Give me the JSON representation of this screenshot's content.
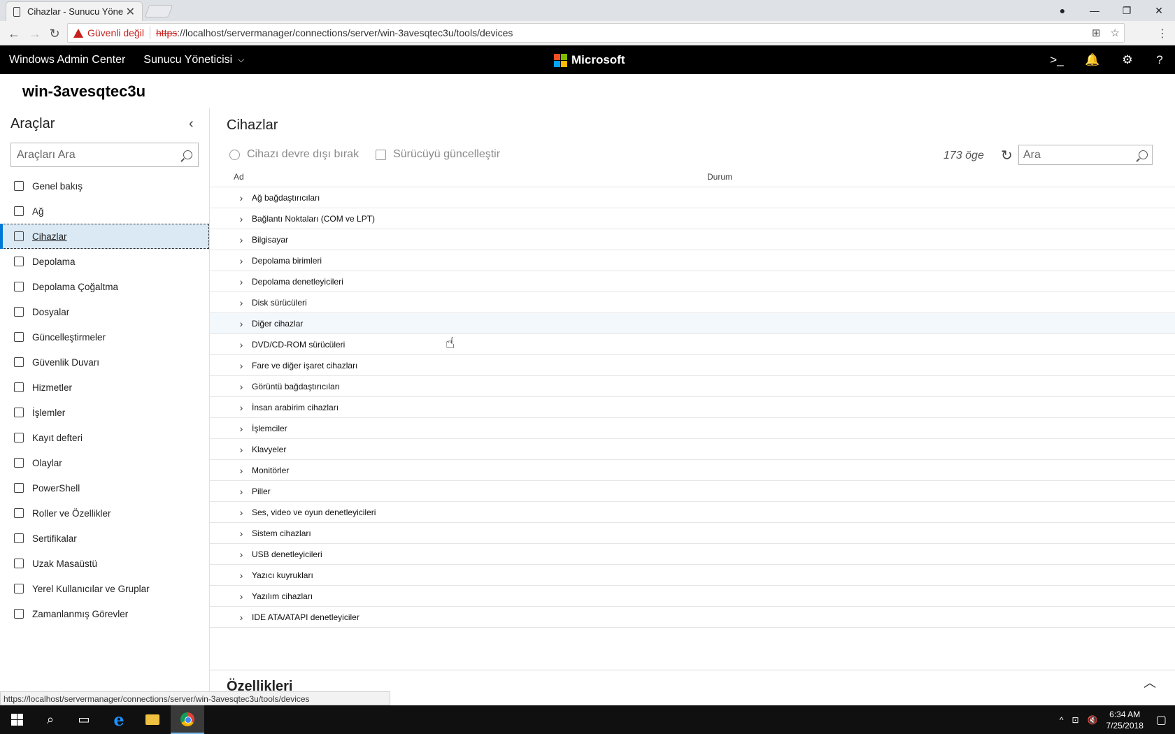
{
  "browser": {
    "tab_title": "Cihazlar - Sunucu Yönetic",
    "security_text": "Güvenli değil",
    "url_scheme": "https",
    "url_rest": "://localhost/servermanager/connections/server/win-3avesqtec3u/tools/devices",
    "status_url": "https://localhost/servermanager/connections/server/win-3avesqtec3u/tools/devices"
  },
  "header": {
    "app_title": "Windows Admin Center",
    "switcher_label": "Sunucu Yöneticisi",
    "brand": "Microsoft"
  },
  "server_name": "win-3avesqtec3u",
  "sidebar": {
    "title": "Araçlar",
    "search_placeholder": "Araçları Ara",
    "items": [
      {
        "label": "Genel bakış",
        "icon": "overview-icon"
      },
      {
        "label": "Ağ",
        "icon": "network-icon"
      },
      {
        "label": "Cihazlar",
        "icon": "devices-icon",
        "active": true
      },
      {
        "label": "Depolama",
        "icon": "storage-icon"
      },
      {
        "label": "Depolama Çoğaltma",
        "icon": "storage-replica-icon"
      },
      {
        "label": "Dosyalar",
        "icon": "files-icon"
      },
      {
        "label": "Güncelleştirmeler",
        "icon": "updates-icon"
      },
      {
        "label": "Güvenlik Duvarı",
        "icon": "firewall-icon"
      },
      {
        "label": "Hizmetler",
        "icon": "services-icon"
      },
      {
        "label": "İşlemler",
        "icon": "processes-icon"
      },
      {
        "label": "Kayıt defteri",
        "icon": "registry-icon"
      },
      {
        "label": "Olaylar",
        "icon": "events-icon"
      },
      {
        "label": "PowerShell",
        "icon": "powershell-icon"
      },
      {
        "label": "Roller ve Özellikler",
        "icon": "roles-icon"
      },
      {
        "label": "Sertifikalar",
        "icon": "certificates-icon"
      },
      {
        "label": "Uzak Masaüstü",
        "icon": "remote-desktop-icon"
      },
      {
        "label": "Yerel Kullanıcılar ve Gruplar",
        "icon": "users-icon"
      },
      {
        "label": "Zamanlanmış Görevler",
        "icon": "scheduled-tasks-icon"
      }
    ]
  },
  "main": {
    "title": "Cihazlar",
    "actions": {
      "disable_device": "Cihazı devre dışı bırak",
      "update_driver": "Sürücüyü güncelleştir"
    },
    "item_count": "173 öge",
    "search_placeholder": "Ara",
    "columns": {
      "name": "Ad",
      "status": "Durum"
    },
    "rows": [
      "Ağ bağdaştırıcıları",
      "Bağlantı Noktaları (COM ve LPT)",
      "Bilgisayar",
      "Depolama birimleri",
      "Depolama denetleyicileri",
      "Disk sürücüleri",
      "Diğer cihazlar",
      "DVD/CD-ROM sürücüleri",
      "Fare ve diğer işaret cihazları",
      "Görüntü bağdaştırıcıları",
      "İnsan arabirim cihazları",
      "İşlemciler",
      "Klavyeler",
      "Monitörler",
      "Piller",
      "Ses, video ve oyun denetleyicileri",
      "Sistem cihazları",
      "USB denetleyicileri",
      "Yazıcı kuyrukları",
      "Yazılım cihazları",
      "IDE ATA/ATAPI denetleyiciler"
    ],
    "properties_title": "Özellikleri"
  },
  "taskbar": {
    "time": "6:34 AM",
    "date": "7/25/2018"
  },
  "colors": {
    "accent": "#0078d7",
    "header_bg": "#000000",
    "warning": "#c5221f"
  }
}
